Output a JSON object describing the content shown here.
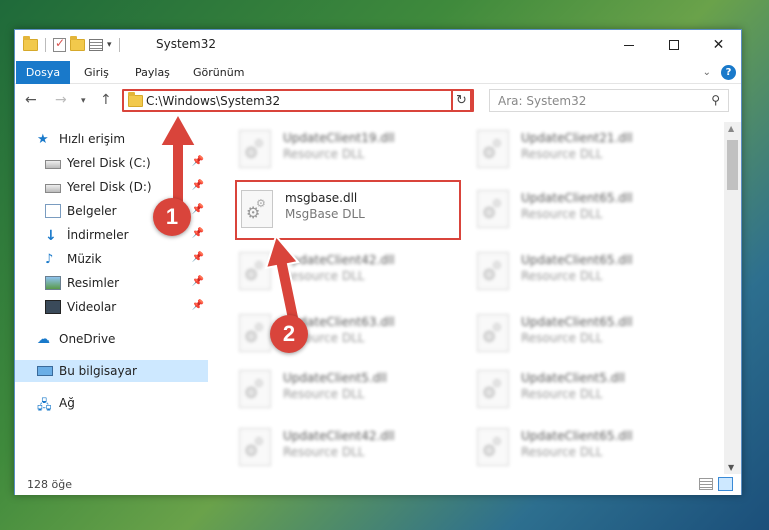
{
  "window": {
    "title": "System32"
  },
  "ribbon": {
    "tabs": [
      "Dosya",
      "Giriş",
      "Paylaş",
      "Görünüm"
    ]
  },
  "nav": {
    "address": "C:\\Windows\\System32",
    "search_placeholder": "Ara: System32"
  },
  "sidebar": {
    "items": [
      {
        "label": "Hızlı erişim",
        "icon": "star-icon"
      },
      {
        "label": "Yerel Disk (C:)",
        "icon": "drive-icon",
        "pinned": true
      },
      {
        "label": "Yerel Disk (D:)",
        "icon": "drive-icon",
        "pinned": true
      },
      {
        "label": "Belgeler",
        "icon": "documents-icon",
        "pinned": true
      },
      {
        "label": "İndirmeler",
        "icon": "downloads-icon",
        "pinned": true
      },
      {
        "label": "Müzik",
        "icon": "music-icon",
        "pinned": true
      },
      {
        "label": "Resimler",
        "icon": "pictures-icon",
        "pinned": true
      },
      {
        "label": "Videolar",
        "icon": "videos-icon",
        "pinned": true
      },
      {
        "label": "OneDrive",
        "icon": "cloud-icon"
      },
      {
        "label": "Bu bilgisayar",
        "icon": "computer-icon",
        "selected": true
      },
      {
        "label": "Ağ",
        "icon": "network-icon"
      }
    ]
  },
  "files": {
    "highlighted": {
      "name": "msgbase.dll",
      "type": "MsgBase DLL"
    },
    "blurred_type": "Resource DLL",
    "left": [
      "UpdateClient19.dll",
      "UpdateClient42.dll",
      "UpdateClient63.dll",
      "UpdateClient5.dll",
      "UpdateClient42.dll"
    ],
    "right": [
      "UpdateClient21.dll",
      "UpdateClient65.dll",
      "UpdateClient65.dll",
      "UpdateClient65.dll",
      "UpdateClient5.dll",
      "UpdateClient65.dll"
    ]
  },
  "status": {
    "count": "128 öğe"
  },
  "annotations": {
    "badge1": "1",
    "badge2": "2",
    "color": "#d9443b"
  },
  "colors": {
    "accent": "#1979ca",
    "highlight": "#d9443b",
    "selected_bg": "#cde8ff"
  }
}
